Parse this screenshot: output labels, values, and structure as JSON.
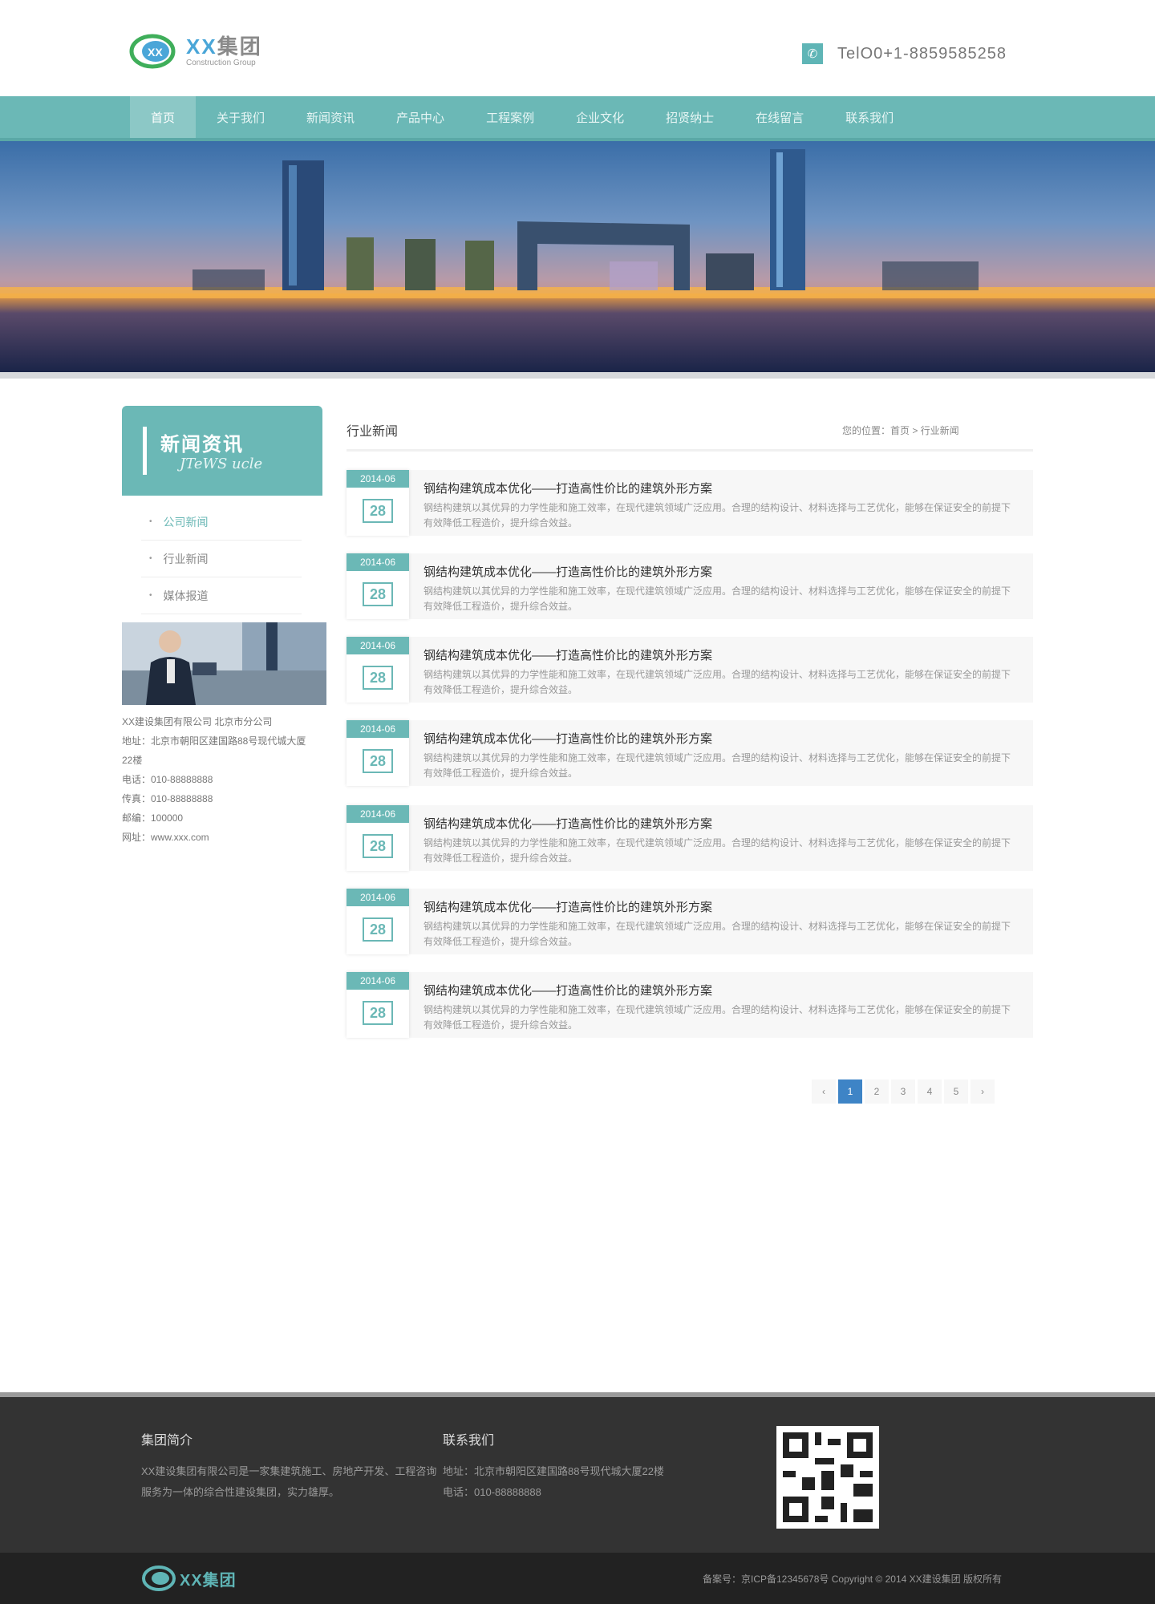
{
  "header": {
    "logo_cn_a": "XX",
    "logo_cn_b": "集团",
    "logo_en": "Construction Group",
    "tel_label": "TelO0+1-8859585258"
  },
  "nav": {
    "items": [
      "首页",
      "关于我们",
      "新闻资讯",
      "产品中心",
      "工程案例",
      "企业文化",
      "招贤纳士",
      "在线留言",
      "联系我们"
    ]
  },
  "sidebar": {
    "title_cn": "新闻资讯",
    "title_en": "JTeWS ucle",
    "menu": [
      "公司新闻",
      "行业新闻",
      "媒体报道"
    ],
    "contact": [
      "XX建设集团有限公司 北京市分公司",
      "地址：北京市朝阳区建国路88号现代城大厦",
      "22楼",
      "电话：010-88888888",
      "传真：010-88888888",
      "邮编：100000",
      "网址：www.xxx.com"
    ]
  },
  "main": {
    "title": "行业新闻",
    "breadcrumb": "您的位置：首页 > 行业新闻",
    "news": [
      {
        "ym": "2014-06",
        "day": "28",
        "title": "钢结构建筑成本优化——打造高性价比的建筑外形方案",
        "desc": "钢结构建筑以其优异的力学性能和施工效率，在现代建筑领域广泛应用。合理的结构设计、材料选择与工艺优化，能够在保证安全的前提下有效降低工程造价，提升综合效益。"
      },
      {
        "ym": "2014-06",
        "day": "28",
        "title": "钢结构建筑成本优化——打造高性价比的建筑外形方案",
        "desc": "钢结构建筑以其优异的力学性能和施工效率，在现代建筑领域广泛应用。合理的结构设计、材料选择与工艺优化，能够在保证安全的前提下有效降低工程造价，提升综合效益。"
      },
      {
        "ym": "2014-06",
        "day": "28",
        "title": "钢结构建筑成本优化——打造高性价比的建筑外形方案",
        "desc": "钢结构建筑以其优异的力学性能和施工效率，在现代建筑领域广泛应用。合理的结构设计、材料选择与工艺优化，能够在保证安全的前提下有效降低工程造价，提升综合效益。"
      },
      {
        "ym": "2014-06",
        "day": "28",
        "title": "钢结构建筑成本优化——打造高性价比的建筑外形方案",
        "desc": "钢结构建筑以其优异的力学性能和施工效率，在现代建筑领域广泛应用。合理的结构设计、材料选择与工艺优化，能够在保证安全的前提下有效降低工程造价，提升综合效益。"
      },
      {
        "ym": "2014-06",
        "day": "28",
        "title": "钢结构建筑成本优化——打造高性价比的建筑外形方案",
        "desc": "钢结构建筑以其优异的力学性能和施工效率，在现代建筑领域广泛应用。合理的结构设计、材料选择与工艺优化，能够在保证安全的前提下有效降低工程造价，提升综合效益。"
      },
      {
        "ym": "2014-06",
        "day": "28",
        "title": "钢结构建筑成本优化——打造高性价比的建筑外形方案",
        "desc": "钢结构建筑以其优异的力学性能和施工效率，在现代建筑领域广泛应用。合理的结构设计、材料选择与工艺优化，能够在保证安全的前提下有效降低工程造价，提升综合效益。"
      },
      {
        "ym": "2014-06",
        "day": "28",
        "title": "钢结构建筑成本优化——打造高性价比的建筑外形方案",
        "desc": "钢结构建筑以其优异的力学性能和施工效率，在现代建筑领域广泛应用。合理的结构设计、材料选择与工艺优化，能够在保证安全的前提下有效降低工程造价，提升综合效益。"
      }
    ]
  },
  "pager": {
    "items": [
      "‹",
      "1",
      "2",
      "3",
      "4",
      "5",
      "›"
    ],
    "active": 1
  },
  "footer": {
    "about_title": "集团简介",
    "about_lines": [
      "XX建设集团有限公司是一家集建筑施工、房地产开发、工程咨询",
      "服务为一体的综合性建设集团，实力雄厚。"
    ],
    "contact_title": "联系我们",
    "contact_lines": [
      "地址：北京市朝阳区建国路88号现代城大厦22楼",
      "电话：010-88888888"
    ],
    "bottom_name": "XX集团",
    "bottom_text": "备案号：京ICP备12345678号      Copyright © 2014 XX建设集团 版权所有"
  },
  "colors": {
    "accent": "#6bb8b6",
    "pager_active": "#3e84c6",
    "footer": "#333333"
  },
  "icons": {
    "tel": "phone-icon",
    "bullet": "bullet-dot-icon"
  }
}
